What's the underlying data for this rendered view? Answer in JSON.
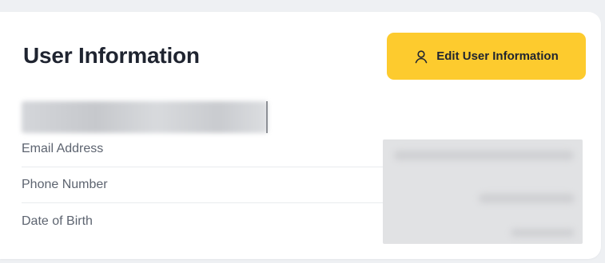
{
  "card": {
    "title": "User Information",
    "edit_button": {
      "label": "Edit User Information",
      "icon": "user-icon"
    }
  },
  "fields": [
    {
      "label": "Email Address"
    },
    {
      "label": "Phone Number"
    },
    {
      "label": "Date of Birth"
    }
  ],
  "colors": {
    "accent": "#fdcb2e",
    "page_background": "#eef0f3",
    "card_background": "#ffffff",
    "label_text": "#5d6470",
    "title_text": "#1f2430"
  }
}
